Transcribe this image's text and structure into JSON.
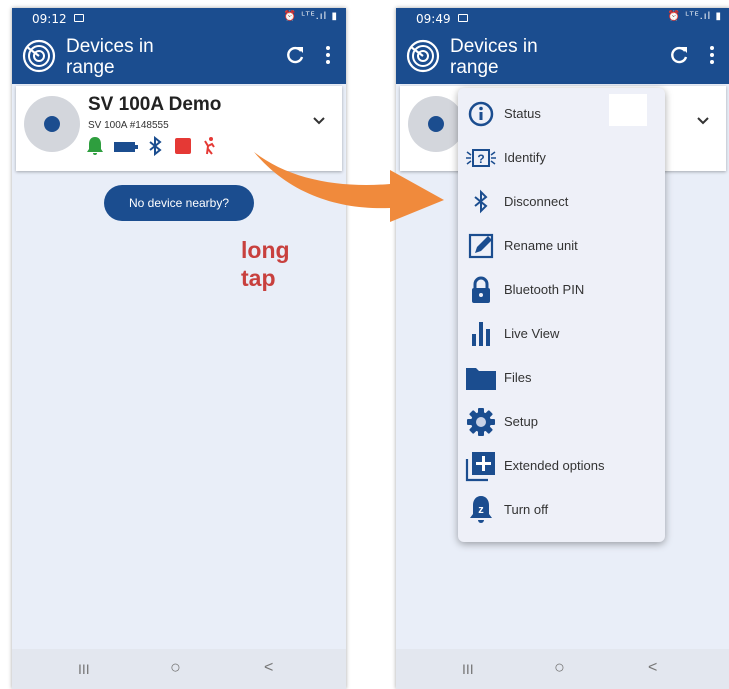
{
  "left_screen": {
    "status_time": "09:12",
    "status_icons": "⏰ ᴸᵀᴱ.ıl ▮",
    "app_title": "Devices in range",
    "device": {
      "name": "SV 100A Demo",
      "model_id": "SV 100A #148555"
    },
    "no_device_button": "No device nearby?",
    "annotation": "long tap"
  },
  "right_screen": {
    "status_time": "09:49",
    "status_icons": "⏰ ᴸᵀᴱ.ıl ▮",
    "app_title": "Devices in range",
    "menu_items": [
      {
        "label": "Status",
        "icon": "info-icon"
      },
      {
        "label": "Identify",
        "icon": "identify-icon"
      },
      {
        "label": "Disconnect",
        "icon": "bluetooth-icon"
      },
      {
        "label": "Rename unit",
        "icon": "pencil-icon"
      },
      {
        "label": "Bluetooth PIN",
        "icon": "lock-icon"
      },
      {
        "label": "Live View",
        "icon": "bars-icon"
      },
      {
        "label": "Files",
        "icon": "folder-icon"
      },
      {
        "label": "Setup",
        "icon": "gear-icon"
      },
      {
        "label": "Extended options",
        "icon": "plus-box-icon"
      },
      {
        "label": "Turn off",
        "icon": "bell-off-icon"
      }
    ]
  },
  "colors": {
    "primary": "#1b4d8f",
    "background": "#e9eef8",
    "accent_arrow": "#f08a3c",
    "annotation_text": "#c8403e",
    "bell_green": "#2e9e3e",
    "stop_red": "#e53935"
  },
  "navbar": {
    "recent": "III",
    "home": "○",
    "back": "<"
  }
}
